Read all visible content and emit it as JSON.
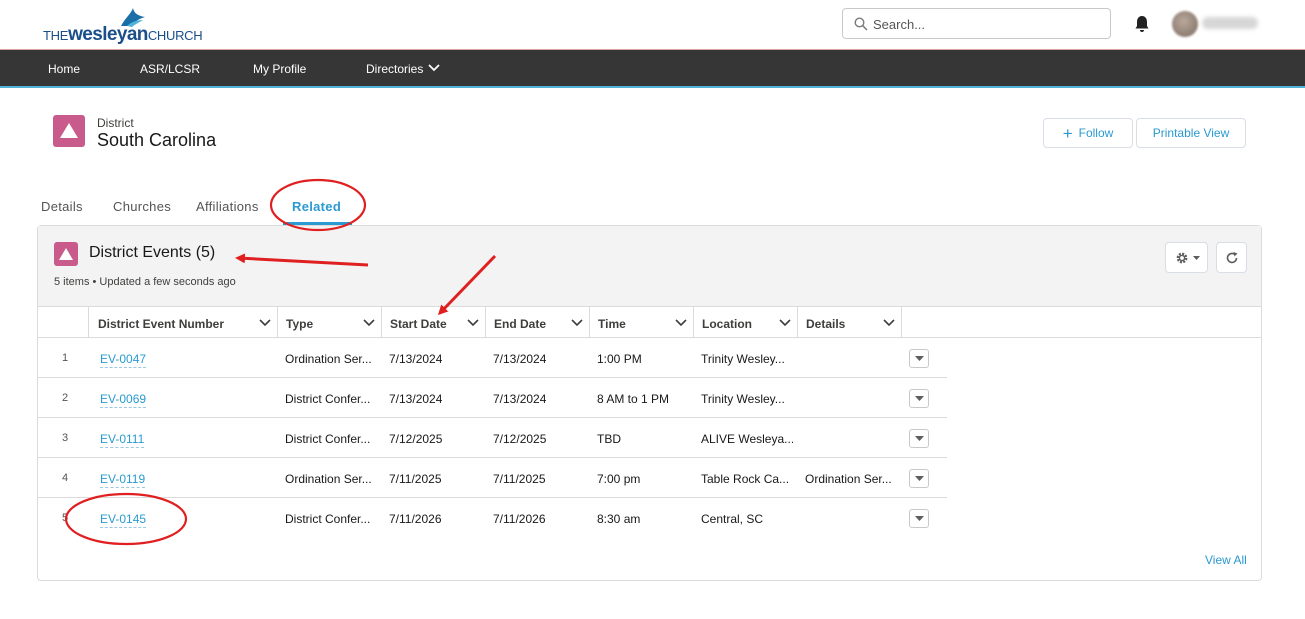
{
  "header": {
    "logo": {
      "prefix": "THE",
      "brand": "wesleyan",
      "suffix": "CHURCH"
    },
    "search": {
      "placeholder": "Search..."
    }
  },
  "nav": {
    "items": [
      {
        "label": "Home"
      },
      {
        "label": "ASR/LCSR"
      },
      {
        "label": "My Profile"
      },
      {
        "label": "Directories"
      }
    ]
  },
  "record": {
    "type": "District",
    "name": "South Carolina",
    "actions": {
      "follow": "Follow",
      "printable_view": "Printable View"
    }
  },
  "tabs": [
    {
      "label": "Details"
    },
    {
      "label": "Churches"
    },
    {
      "label": "Affiliations"
    },
    {
      "label": "Related",
      "active": true
    }
  ],
  "related_list": {
    "title": "District Events (5)",
    "subtitle": "5 items • Updated a few seconds ago",
    "columns": [
      "District Event Number",
      "Type",
      "Start Date",
      "End Date",
      "Time",
      "Location",
      "Details"
    ],
    "rows": [
      {
        "num": "1",
        "event": "EV-0047",
        "type": "Ordination Ser...",
        "start": "7/13/2024",
        "end": "7/13/2024",
        "time": "1:00 PM",
        "location": "Trinity Wesley...",
        "details": ""
      },
      {
        "num": "2",
        "event": "EV-0069",
        "type": "District Confer...",
        "start": "7/13/2024",
        "end": "7/13/2024",
        "time": "8 AM to 1 PM",
        "location": "Trinity Wesley...",
        "details": ""
      },
      {
        "num": "3",
        "event": "EV-0111",
        "type": "District Confer...",
        "start": "7/12/2025",
        "end": "7/12/2025",
        "time": "TBD",
        "location": "ALIVE Wesleya...",
        "details": ""
      },
      {
        "num": "4",
        "event": "EV-0119",
        "type": "Ordination Ser...",
        "start": "7/11/2025",
        "end": "7/11/2025",
        "time": "7:00 pm",
        "location": "Table Rock Ca...",
        "details": "Ordination Ser..."
      },
      {
        "num": "5",
        "event": "EV-0145",
        "type": "District Confer...",
        "start": "7/11/2026",
        "end": "7/11/2026",
        "time": "8:30 am",
        "location": "Central, SC",
        "details": ""
      }
    ],
    "view_all": "View All"
  },
  "icons": {
    "search": "search-icon",
    "bell": "bell-icon",
    "record": "triangle-icon",
    "gear": "gear-icon",
    "refresh": "refresh-icon",
    "row_menu": "chevron-down-icon"
  },
  "colors": {
    "accent": "#2a9ad0",
    "nav_bg": "#363636",
    "record_icon": "#c85a8c",
    "annotation": "#e02020"
  }
}
